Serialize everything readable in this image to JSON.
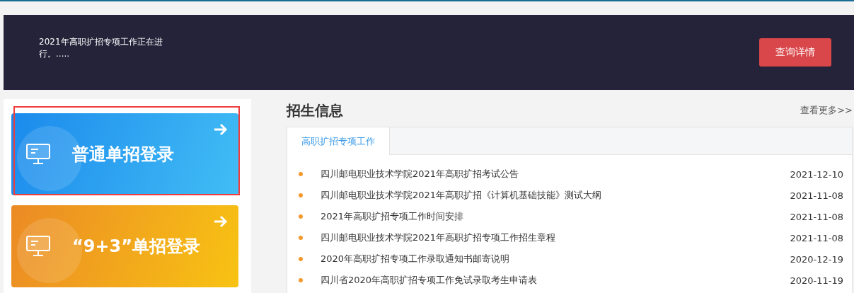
{
  "banner": {
    "text": "2021年高职扩招专项工作正在进行。.....",
    "button": "查询详情"
  },
  "login_cards": [
    {
      "label": "普通单招登录",
      "kind": "blue",
      "highlighted": true
    },
    {
      "label": "“9+3”单招登录",
      "kind": "orange",
      "highlighted": false
    }
  ],
  "news": {
    "title": "招生信息",
    "more": "查看更多>>",
    "tabs": [
      {
        "label": "高职扩招专项工作",
        "selected": true
      }
    ],
    "items": [
      {
        "title": "四川邮电职业技术学院2021年高职扩招考试公告",
        "date": "2021-12-10"
      },
      {
        "title": "四川邮电职业技术学院2021年高职扩招《计算机基础技能》测试大纲",
        "date": "2021-11-08"
      },
      {
        "title": "2021年高职扩招专项工作时间安排",
        "date": "2021-11-08"
      },
      {
        "title": "四川邮电职业技术学院2021年高职扩招专项工作招生章程",
        "date": "2021-11-08"
      },
      {
        "title": "2020年高职扩招专项工作录取通知书邮寄说明",
        "date": "2020-12-19"
      },
      {
        "title": "四川省2020年高职扩招专项工作免试录取考生申请表",
        "date": "2020-11-19"
      }
    ]
  }
}
